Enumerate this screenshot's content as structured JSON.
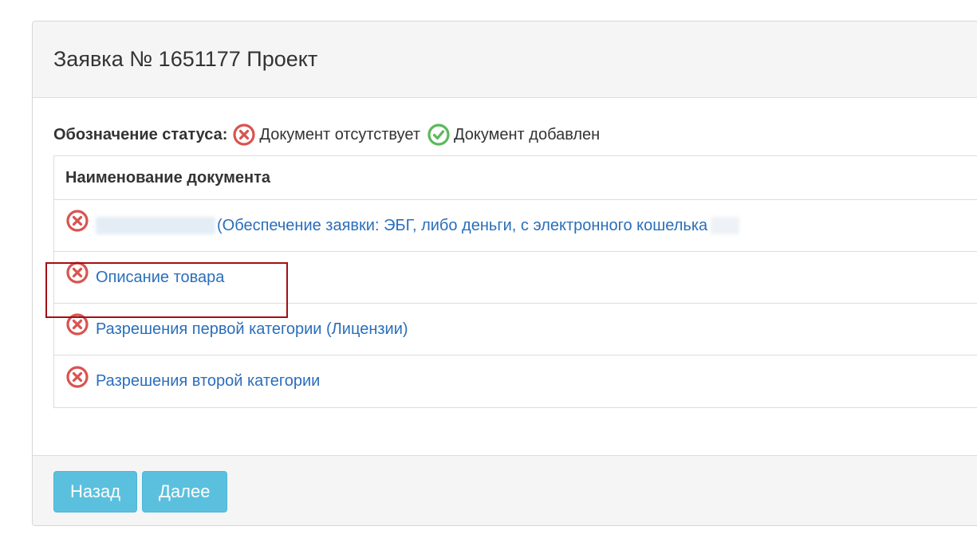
{
  "panel": {
    "title": "Заявка № 1651177 Проект"
  },
  "legend": {
    "label": "Обозначение статуса:",
    "missing_text": "Документ отсутствует",
    "added_text": "Документ добавлен"
  },
  "table": {
    "header": "Наименование документа",
    "rows": [
      {
        "label": "(Обеспечение заявки: ЭБГ, либо деньги, с электронного кошелька",
        "status": "missing"
      },
      {
        "label": "Описание товара",
        "status": "missing"
      },
      {
        "label": "Разрешения первой категории (Лицензии)",
        "status": "missing"
      },
      {
        "label": "Разрешения второй категории",
        "status": "missing"
      }
    ]
  },
  "footer": {
    "back_label": "Назад",
    "next_label": "Далее"
  },
  "colors": {
    "missing_icon": "#d9534f",
    "added_icon": "#5cb85c",
    "link": "#2a6ebb",
    "button": "#5bc0de",
    "highlight": "#a30f14"
  }
}
